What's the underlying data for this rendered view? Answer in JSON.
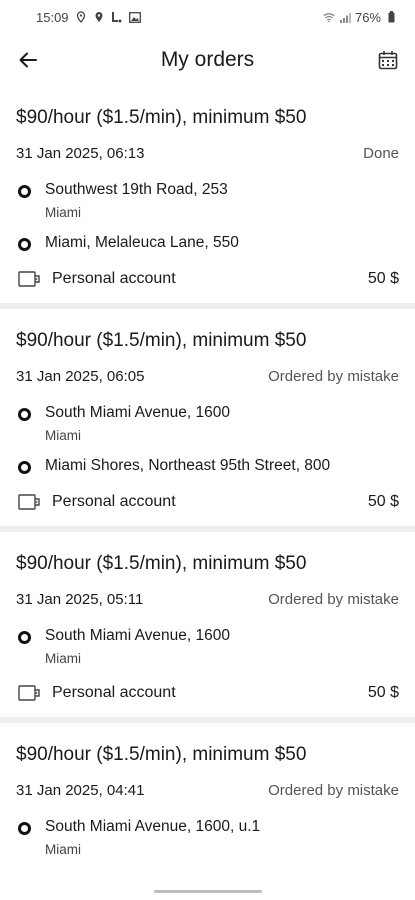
{
  "status_bar": {
    "time": "15:09",
    "battery": "76%"
  },
  "header": {
    "title": "My orders"
  },
  "orders": [
    {
      "tariff": "$90/hour ($1.5/min), minimum $50",
      "datetime": "31 Jan 2025, 06:13",
      "status": "Done",
      "points": [
        {
          "address": "Southwest 19th Road, 253",
          "city": "Miami"
        },
        {
          "address": "Miami, Melaleuca Lane, 550",
          "city": ""
        }
      ],
      "payment": {
        "label": "Personal account",
        "amount": "50 $"
      }
    },
    {
      "tariff": "$90/hour ($1.5/min), minimum $50",
      "datetime": "31 Jan 2025, 06:05",
      "status": "Ordered by mistake",
      "points": [
        {
          "address": "South Miami Avenue, 1600",
          "city": "Miami"
        },
        {
          "address": "Miami Shores, Northeast 95th Street, 800",
          "city": ""
        }
      ],
      "payment": {
        "label": "Personal account",
        "amount": "50 $"
      }
    },
    {
      "tariff": "$90/hour ($1.5/min), minimum $50",
      "datetime": "31 Jan 2025, 05:11",
      "status": "Ordered by mistake",
      "points": [
        {
          "address": "South Miami Avenue, 1600",
          "city": "Miami"
        }
      ],
      "payment": {
        "label": "Personal account",
        "amount": "50 $"
      }
    },
    {
      "tariff": "$90/hour ($1.5/min), minimum $50",
      "datetime": "31 Jan 2025, 04:41",
      "status": "Ordered by mistake",
      "points": [
        {
          "address": "South Miami Avenue, 1600, u.1",
          "city": "Miami"
        }
      ],
      "payment": null
    }
  ],
  "icons": {
    "back": "arrow-left-icon",
    "calendar": "calendar-icon",
    "point": "route-point-icon",
    "wallet": "wallet-icon"
  }
}
